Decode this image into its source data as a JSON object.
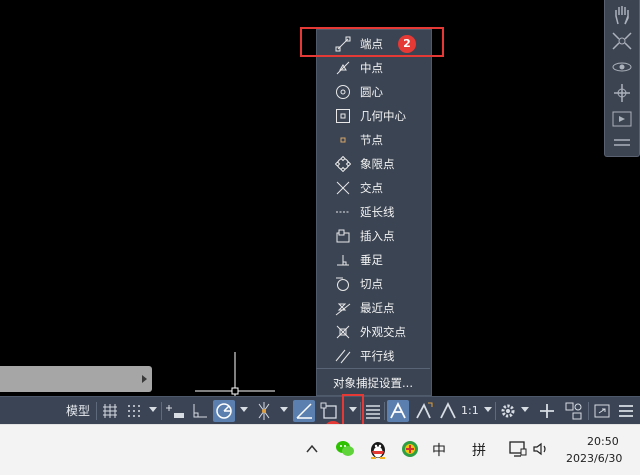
{
  "menu": {
    "items": [
      {
        "label": "端点",
        "icon": "endpoint-icon"
      },
      {
        "label": "中点",
        "icon": "midpoint-icon"
      },
      {
        "label": "圆心",
        "icon": "center-icon"
      },
      {
        "label": "几何中心",
        "icon": "geometric-center-icon"
      },
      {
        "label": "节点",
        "icon": "node-icon"
      },
      {
        "label": "象限点",
        "icon": "quadrant-icon"
      },
      {
        "label": "交点",
        "icon": "intersection-icon"
      },
      {
        "label": "延长线",
        "icon": "extension-icon"
      },
      {
        "label": "插入点",
        "icon": "insertion-icon"
      },
      {
        "label": "垂足",
        "icon": "perpendicular-icon"
      },
      {
        "label": "切点",
        "icon": "tangent-icon"
      },
      {
        "label": "最近点",
        "icon": "nearest-icon"
      },
      {
        "label": "外观交点",
        "icon": "apparent-intersection-icon"
      },
      {
        "label": "平行线",
        "icon": "parallel-icon"
      }
    ],
    "settings_label": "对象捕捉设置..."
  },
  "annotations": {
    "badge1": "1",
    "badge2": "2",
    "color": "#e53935"
  },
  "statusbar": {
    "model_label": "模型",
    "scale_label": "1:1",
    "accent": "#5b7fae"
  },
  "taskbar": {
    "ime_lang": "中",
    "ime_mode": "拼",
    "time": "20:50",
    "date": "2023/6/30"
  }
}
